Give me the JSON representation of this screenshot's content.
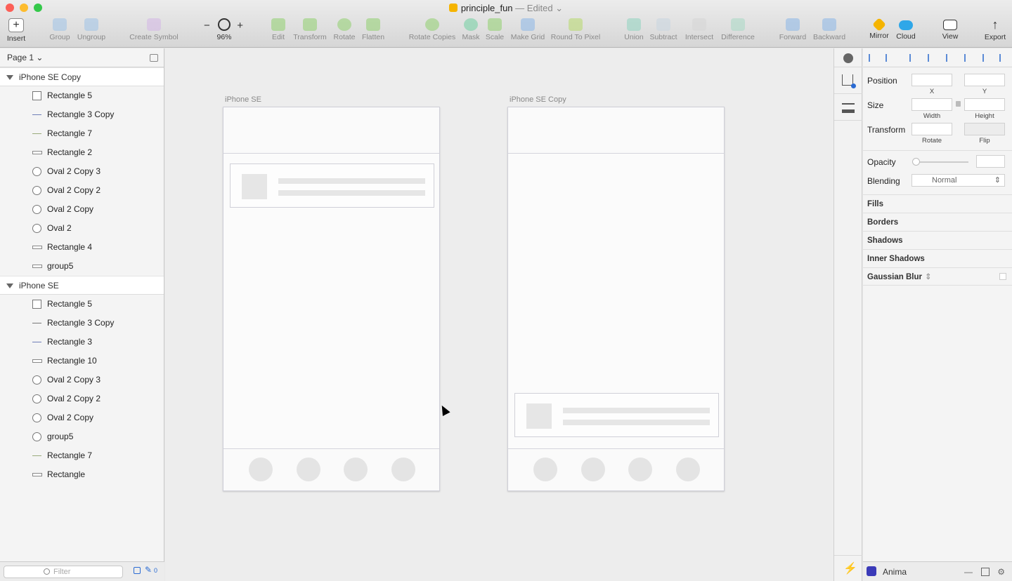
{
  "window": {
    "doc_title": "principle_fun",
    "edited_label": "— Edited",
    "edited_chevron": "⌄"
  },
  "toolbar": {
    "insert": "Insert",
    "group": "Group",
    "ungroup": "Ungroup",
    "create_symbol": "Create Symbol",
    "zoom": "96%",
    "zoom_minus": "−",
    "zoom_plus": "+",
    "edit": "Edit",
    "transform": "Transform",
    "rotate": "Rotate",
    "flatten": "Flatten",
    "rotate_copies": "Rotate Copies",
    "mask": "Mask",
    "scale": "Scale",
    "make_grid": "Make Grid",
    "round_to_pixel": "Round To Pixel",
    "union": "Union",
    "subtract": "Subtract",
    "intersect": "Intersect",
    "difference": "Difference",
    "forward": "Forward",
    "backward": "Backward",
    "mirror": "Mirror",
    "cloud": "Cloud",
    "view": "View",
    "export": "Export"
  },
  "layers": {
    "page": "Page 1 ⌄",
    "groups": [
      {
        "name": "iPhone SE Copy",
        "items": [
          {
            "label": "Rectangle 5",
            "icon": "rect"
          },
          {
            "label": "Rectangle 3 Copy",
            "icon": "line-blue"
          },
          {
            "label": "Rectangle 7",
            "icon": "line-green"
          },
          {
            "label": "Rectangle 2",
            "icon": "flat"
          },
          {
            "label": "Oval 2 Copy 3",
            "icon": "oval"
          },
          {
            "label": "Oval 2 Copy 2",
            "icon": "oval"
          },
          {
            "label": "Oval 2 Copy",
            "icon": "oval"
          },
          {
            "label": "Oval 2",
            "icon": "oval"
          },
          {
            "label": "Rectangle 4",
            "icon": "flat"
          },
          {
            "label": "group5",
            "icon": "flat"
          }
        ]
      },
      {
        "name": "iPhone SE",
        "items": [
          {
            "label": "Rectangle 5",
            "icon": "rect"
          },
          {
            "label": "Rectangle 3 Copy",
            "icon": "line"
          },
          {
            "label": "Rectangle 3",
            "icon": "line-blue"
          },
          {
            "label": "Rectangle 10",
            "icon": "flat"
          },
          {
            "label": "Oval 2 Copy 3",
            "icon": "oval"
          },
          {
            "label": "Oval 2 Copy 2",
            "icon": "oval"
          },
          {
            "label": "Oval 2 Copy",
            "icon": "oval"
          },
          {
            "label": "group5",
            "icon": "oval"
          },
          {
            "label": "Rectangle 7",
            "icon": "line-green"
          },
          {
            "label": "Rectangle",
            "icon": "flat"
          }
        ]
      }
    ],
    "filter_placeholder": "Filter",
    "filter_count": "0"
  },
  "canvas": {
    "artboard_1": "iPhone SE",
    "artboard_2": "iPhone SE Copy"
  },
  "inspector": {
    "position": "Position",
    "x": "X",
    "y": "Y",
    "size": "Size",
    "width": "Width",
    "height": "Height",
    "transform": "Transform",
    "rotate": "Rotate",
    "flip": "Flip",
    "opacity": "Opacity",
    "blending": "Blending",
    "blending_value": "Normal",
    "fills": "Fills",
    "borders": "Borders",
    "shadows": "Shadows",
    "inner_shadows": "Inner Shadows",
    "gaussian_blur": "Gaussian Blur",
    "plugin": "Anima"
  },
  "colors": {
    "close": "#fc5f57",
    "minimize": "#fdbc2e",
    "zoom": "#34c84a",
    "accent": "#2a6bd3"
  }
}
